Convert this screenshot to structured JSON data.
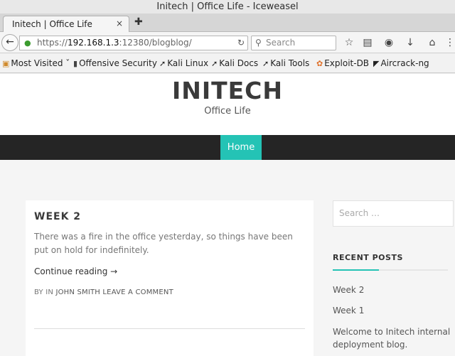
{
  "window": {
    "title": "Initech | Office Life - Iceweasel"
  },
  "tab": {
    "title": "Initech | Office Life",
    "close_glyph": "×",
    "new_glyph": "✚"
  },
  "nav": {
    "back_glyph": "←",
    "url_scheme": "https://",
    "url_host": "192.168.1.3",
    "url_rest": ":12380/blogblog/",
    "search_placeholder": "Search"
  },
  "bookmarks": [
    {
      "label": "Most Visited",
      "icon": "folder-icon"
    },
    {
      "label": "Offensive Security",
      "icon": "offsec-icon"
    },
    {
      "label": "Kali Linux",
      "icon": "kali-icon"
    },
    {
      "label": "Kali Docs",
      "icon": "kali-icon"
    },
    {
      "label": "Kali Tools",
      "icon": "kali-icon"
    },
    {
      "label": "Exploit-DB",
      "icon": "exploitdb-icon"
    },
    {
      "label": "Aircrack-ng",
      "icon": "aircrack-icon"
    }
  ],
  "site": {
    "title": "INITECH",
    "description": "Office Life",
    "menu": {
      "home": "Home"
    }
  },
  "post": {
    "title": "WEEK 2",
    "excerpt": "There was a fire in the office yesterday, so things have been put on hold for indefinitely.",
    "continue": "Continue reading →",
    "meta_by": "BY",
    "meta_in": "IN",
    "meta_author": "JOHN SMITH",
    "meta_comment": "LEAVE A COMMENT"
  },
  "sidebar": {
    "search_placeholder": "Search …",
    "recent_title": "RECENT POSTS",
    "recent_posts": [
      "Week 2",
      "Week 1",
      "Welcome to Initech internal deployment blog."
    ]
  },
  "colors": {
    "accent": "#24c3b5",
    "menubar": "#252525"
  }
}
